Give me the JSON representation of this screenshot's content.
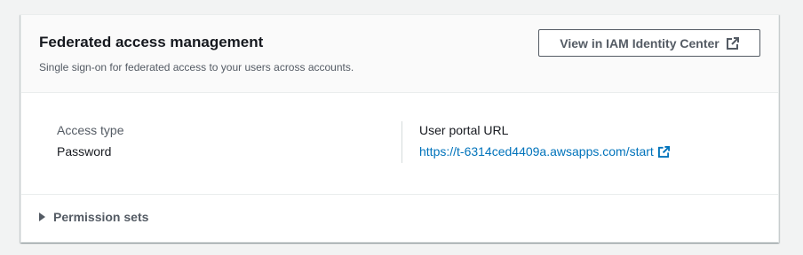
{
  "panel": {
    "title": "Federated access management",
    "description": "Single sign-on for federated access to your users across accounts.",
    "button_label": "View in IAM Identity Center",
    "button_icon": "external-link-icon"
  },
  "details": {
    "access_type_label": "Access type",
    "access_type_value": "Password",
    "portal_label": "User portal URL",
    "portal_url": "https://t-6314ced4409a.awsapps.com/start",
    "portal_icon": "external-link-icon"
  },
  "permission_sets": {
    "label": "Permission sets",
    "expanded": false
  },
  "colors": {
    "link": "#0073bb",
    "text": "#16191f",
    "secondary_text": "#545b64",
    "background": "#f2f3f3"
  }
}
